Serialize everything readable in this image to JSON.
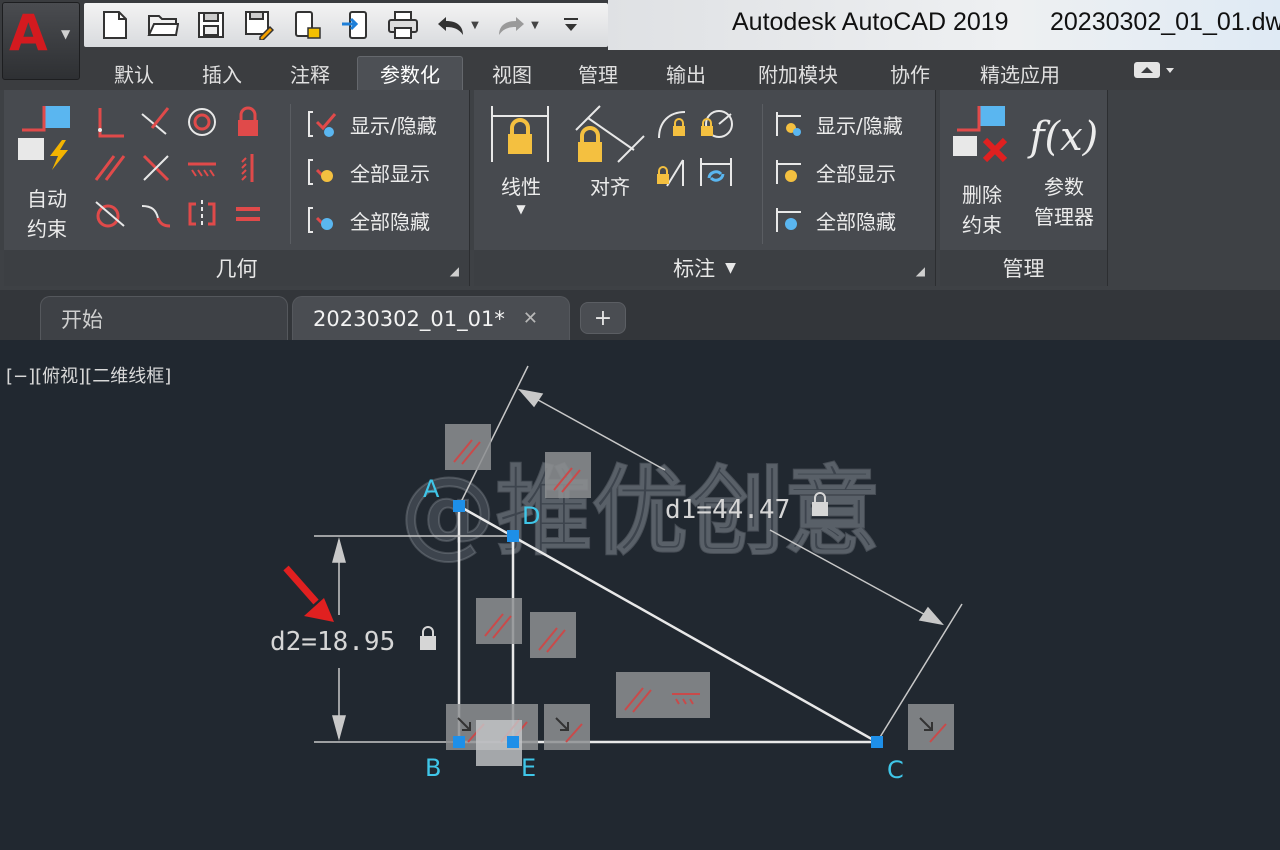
{
  "app": {
    "logo_letter": "A",
    "title": "Autodesk AutoCAD 2019",
    "file_title": "20230302_01_01.dw"
  },
  "ribbon_tabs": [
    "默认",
    "插入",
    "注释",
    "参数化",
    "视图",
    "管理",
    "输出",
    "附加模块",
    "协作",
    "精选应用"
  ],
  "active_ribbon_tab": "参数化",
  "panels": {
    "geometry": {
      "title": "几何",
      "auto_constrain": [
        "自动",
        "约束"
      ],
      "show_hide": "显示/隐藏",
      "show_all": "全部显示",
      "hide_all": "全部隐藏"
    },
    "dimension": {
      "title": "标注",
      "linear": "线性",
      "aligned": "对齐",
      "show_hide": "显示/隐藏",
      "show_all": "全部显示",
      "hide_all": "全部隐藏"
    },
    "manage": {
      "title": "管理",
      "delete_constraints": [
        "删除",
        "约束"
      ],
      "param_manager": [
        "参数",
        "管理器"
      ],
      "fx_label": "f(x)"
    }
  },
  "document_tabs": [
    {
      "label": "开始",
      "active": false
    },
    {
      "label": "20230302_01_01*",
      "active": true
    }
  ],
  "viewport_label": "[−][俯视][二维线框]",
  "drawing": {
    "points": {
      "A": "A",
      "B": "B",
      "C": "C",
      "D": "D",
      "E": "E"
    },
    "dim_d1": "d1=44.47",
    "dim_d2": "d2=18.95",
    "watermark": "@推优创意"
  },
  "colors": {
    "canvas_bg": "#212830",
    "line": "#e8e8e8",
    "point_label": "#3fc6e8",
    "grip": "#1e8fe8",
    "arrow_red": "#e02020",
    "constraint_glyph": "#c94a4a"
  }
}
